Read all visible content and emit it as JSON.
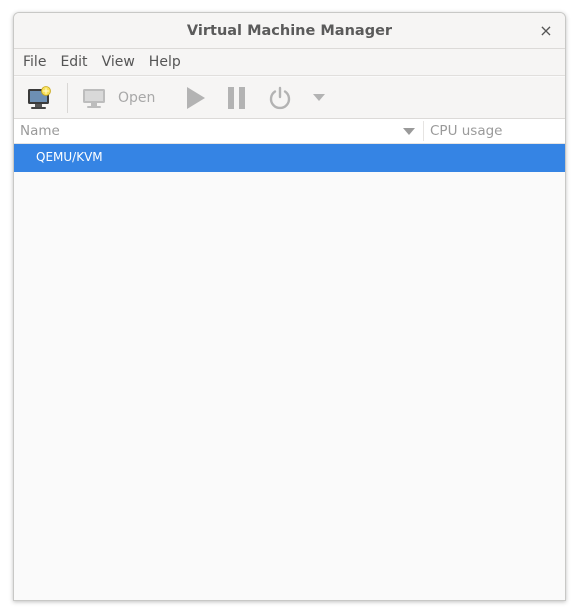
{
  "window": {
    "title": "Virtual Machine Manager",
    "close_glyph": "×"
  },
  "menubar": {
    "items": [
      "File",
      "Edit",
      "View",
      "Help"
    ]
  },
  "toolbar": {
    "new_vm_icon": "new-vm-icon",
    "open_label": "Open",
    "run_icon": "play-icon",
    "pause_icon": "pause-icon",
    "shutdown_icon": "power-icon",
    "menu_icon": "chevron-down-icon"
  },
  "list": {
    "columns": [
      "Name",
      "CPU usage"
    ],
    "rows": [
      {
        "name": "QEMU/KVM",
        "selected": true
      }
    ]
  },
  "colors": {
    "selection": "#3584e4",
    "disabled_icon": "#b3b3b3"
  }
}
